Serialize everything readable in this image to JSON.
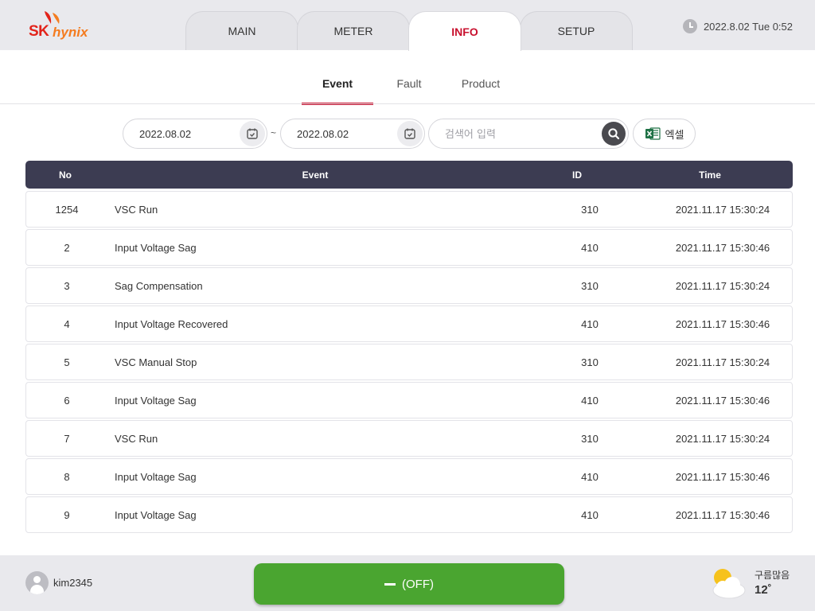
{
  "brand": {
    "logo_primary": "SK",
    "logo_secondary": "hynix",
    "color_red": "#e2231a",
    "color_orange": "#f47c20"
  },
  "nav": {
    "tabs": [
      {
        "label": "MAIN",
        "active": false
      },
      {
        "label": "METER",
        "active": false
      },
      {
        "label": "INFO",
        "active": true
      },
      {
        "label": "SETUP",
        "active": false
      }
    ]
  },
  "header": {
    "datetime": "2022.8.02 Tue 0:52",
    "clock_icon": "clock-icon"
  },
  "subtabs": [
    {
      "label": "Event",
      "active": true
    },
    {
      "label": "Fault",
      "active": false
    },
    {
      "label": "Product",
      "active": false
    }
  ],
  "filters": {
    "start_date": "2022.08.02",
    "separator": "~",
    "end_date": "2022.08.02",
    "search_placeholder": "검색어 입력",
    "excel_label": "엑셀"
  },
  "table": {
    "columns": {
      "no": "No",
      "event": "Event",
      "id": "ID",
      "time": "Time"
    },
    "rows": [
      {
        "no": "1254",
        "event": "VSC Run",
        "id": "310",
        "time": "2021.11.17 15:30:24"
      },
      {
        "no": "2",
        "event": "Input Voltage Sag",
        "id": "410",
        "time": "2021.11.17 15:30:46"
      },
      {
        "no": "3",
        "event": "Sag Compensation",
        "id": "310",
        "time": "2021.11.17 15:30:24"
      },
      {
        "no": "4",
        "event": "Input Voltage Recovered",
        "id": "410",
        "time": "2021.11.17 15:30:46"
      },
      {
        "no": "5",
        "event": "VSC Manual Stop",
        "id": "310",
        "time": "2021.11.17 15:30:24"
      },
      {
        "no": "6",
        "event": "Input Voltage Sag",
        "id": "410",
        "time": "2021.11.17 15:30:46"
      },
      {
        "no": "7",
        "event": "VSC Run",
        "id": "310",
        "time": "2021.11.17 15:30:24"
      },
      {
        "no": "8",
        "event": "Input Voltage Sag",
        "id": "410",
        "time": "2021.11.17 15:30:46"
      },
      {
        "no": "9",
        "event": "Input Voltage Sag",
        "id": "410",
        "time": "2021.11.17 15:30:46"
      }
    ]
  },
  "footer": {
    "username": "kim2345",
    "power_label": "(OFF)",
    "power_color": "#4aa530",
    "weather_condition": "구름많음",
    "weather_temp": "12˚",
    "weather_icon": "partly-cloudy-icon"
  },
  "colors": {
    "accent": "#c8102e",
    "table_header": "#3c3c52"
  }
}
